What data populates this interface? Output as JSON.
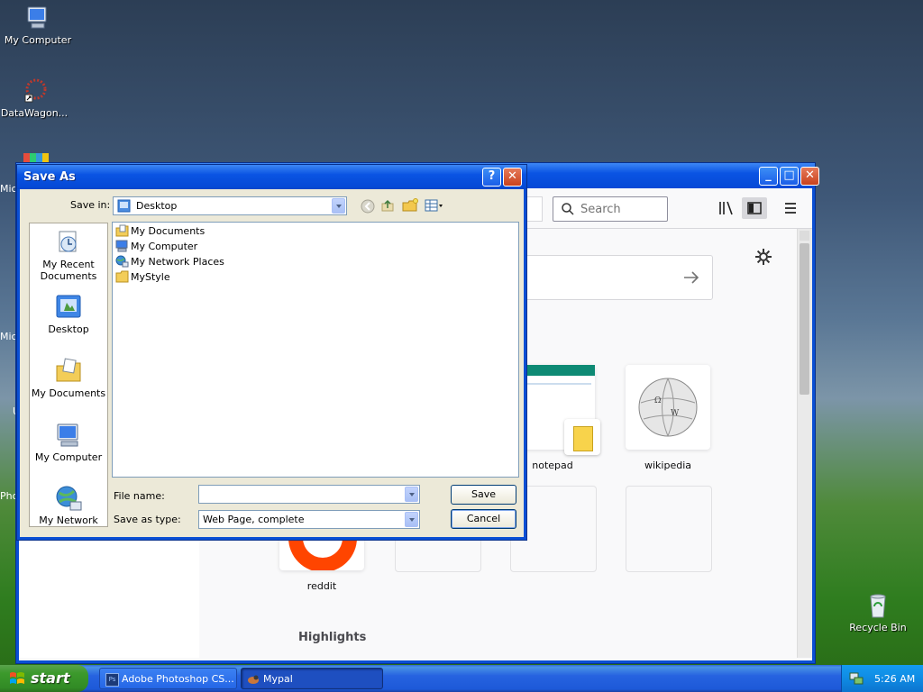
{
  "desktop": {
    "icons": [
      {
        "label": "My Computer"
      },
      {
        "label": "DataWagon..."
      },
      {
        "label": "Recycle Bin"
      }
    ],
    "partial_labels": [
      "Mic",
      "Mic",
      "U",
      "Pho"
    ]
  },
  "firefox": {
    "search_placeholder": "Search",
    "tiles": [
      {
        "label": "notepad"
      },
      {
        "label": "wikipedia"
      },
      {
        "label": "reddit"
      }
    ],
    "highlights_heading": "Highlights"
  },
  "save_dialog": {
    "title": "Save As",
    "help_glyph": "?",
    "close_glyph": "✕",
    "save_in_label": "Save in:",
    "save_in_value": "Desktop",
    "places": [
      {
        "label": "My Recent Documents"
      },
      {
        "label": "Desktop"
      },
      {
        "label": "My Documents"
      },
      {
        "label": "My Computer"
      },
      {
        "label": "My Network"
      }
    ],
    "files": [
      {
        "name": "My Documents",
        "icon": "documents-folder-icon"
      },
      {
        "name": "My Computer",
        "icon": "computer-icon"
      },
      {
        "name": "My Network Places",
        "icon": "network-icon"
      },
      {
        "name": "MyStyle",
        "icon": "folder-icon"
      }
    ],
    "file_name_label": "File name:",
    "file_name_value": "",
    "save_as_type_label": "Save as type:",
    "save_as_type_value": "Web Page, complete",
    "save_button": "Save",
    "cancel_button": "Cancel"
  },
  "taskbar": {
    "start_label": "start",
    "tasks": [
      {
        "label": "Adobe Photoshop CS..."
      },
      {
        "label": "Mypal"
      }
    ],
    "clock": "5:26 AM"
  },
  "colors": {
    "xp_blue": "#0a54e3",
    "dialog_bg": "#ece9d8",
    "start_green": "#3c9a2c"
  }
}
